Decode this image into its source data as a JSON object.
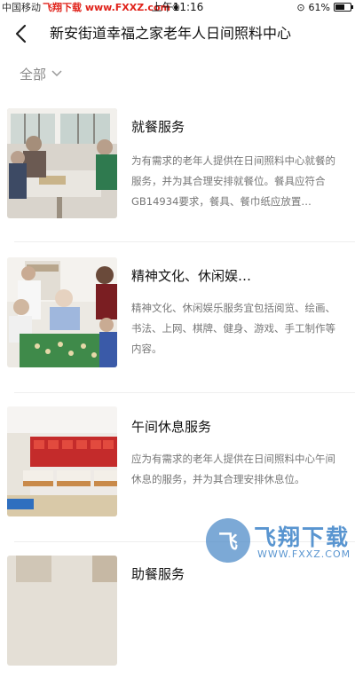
{
  "status_bar": {
    "carrier": "中国移动",
    "site": "飞翔下载 www.FXXZ.com",
    "time": "上午11:16",
    "battery": "61%",
    "battery_level": 0.61
  },
  "nav": {
    "back_icon": "chevron-left-icon",
    "title": "新安街道幸福之家老年人日间照料中心"
  },
  "filter": {
    "label": "全部",
    "icon": "chevron-down-icon"
  },
  "items": [
    {
      "title": "就餐服务",
      "desc": "为有需求的老年人提供在日间照料中心就餐的服务，并为其合理安排就餐位。餐具应符合GB14934要求，餐具、餐巾纸应放置…"
    },
    {
      "title": "精神文化、休闲娱…",
      "desc": "精神文化、休闲娱乐服务宜包括阅览、绘画、书法、上网、棋牌、健身、游戏、手工制作等内容。"
    },
    {
      "title": "午间休息服务",
      "desc": "应为有需求的老年人提供在日间照料中心午间休息的服务，并为其合理安排休息位。"
    },
    {
      "title": "助餐服务",
      "desc": ""
    }
  ],
  "watermark": {
    "text": "飞翔下载",
    "sub": "WWW.FXXZ.COM"
  }
}
